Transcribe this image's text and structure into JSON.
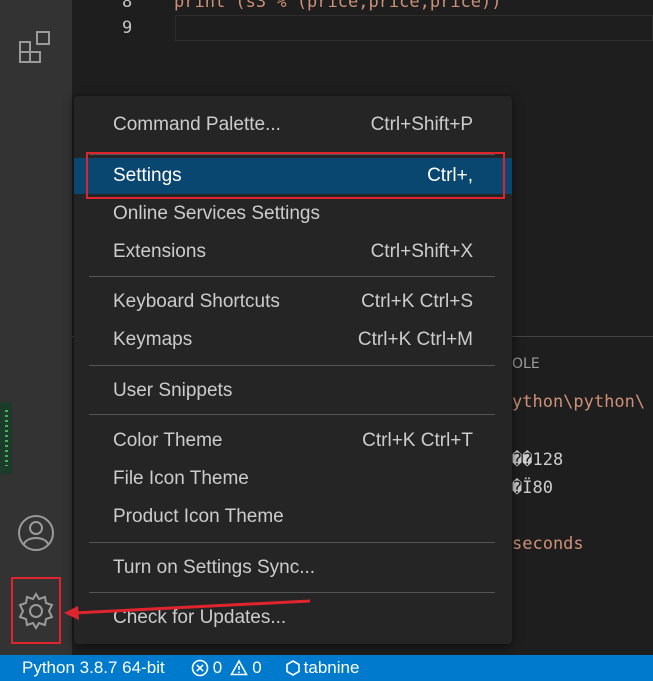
{
  "editor": {
    "lines": [
      {
        "num": "8",
        "code": "print (s3 % (price,price,price))"
      },
      {
        "num": "9",
        "code": ""
      }
    ]
  },
  "panel": {
    "tab_label": "OLE",
    "terminal_lines": [
      {
        "text": "ython\\python\\",
        "color": "#ce9178"
      },
      {
        "text": "��128",
        "color": "#cccccc"
      },
      {
        "text": "�Ï80",
        "color": "#cccccc"
      },
      {
        "text": "seconds",
        "color": "#ce9178"
      }
    ]
  },
  "menu": {
    "items": [
      {
        "label": "Command Palette...",
        "shortcut": "Ctrl+Shift+P"
      },
      {
        "label": "Settings",
        "shortcut": "Ctrl+,",
        "active": true
      },
      {
        "label": "Online Services Settings",
        "shortcut": ""
      },
      {
        "label": "Extensions",
        "shortcut": "Ctrl+Shift+X"
      },
      {
        "label": "Keyboard Shortcuts",
        "shortcut": "Ctrl+K Ctrl+S"
      },
      {
        "label": "Keymaps",
        "shortcut": "Ctrl+K Ctrl+M"
      },
      {
        "label": "User Snippets",
        "shortcut": ""
      },
      {
        "label": "Color Theme",
        "shortcut": "Ctrl+K Ctrl+T"
      },
      {
        "label": "File Icon Theme",
        "shortcut": ""
      },
      {
        "label": "Product Icon Theme",
        "shortcut": ""
      },
      {
        "label": "Turn on Settings Sync...",
        "shortcut": ""
      },
      {
        "label": "Check for Updates...",
        "shortcut": ""
      }
    ]
  },
  "status_bar": {
    "python": "Python 3.8.7 64-bit",
    "errors": "0",
    "warnings": "0",
    "tabnine": "tabnine"
  },
  "icons": {
    "extensions": "extensions-icon",
    "account": "account-icon",
    "settings": "gear-icon",
    "error": "error-icon",
    "warning": "warning-icon",
    "tabnine": "tabnine-icon"
  },
  "colors": {
    "activity_bar": "#333333",
    "menu_background": "#252526",
    "menu_active": "#094771",
    "status_bar": "#007acc",
    "annotation_red": "#e0242d"
  }
}
